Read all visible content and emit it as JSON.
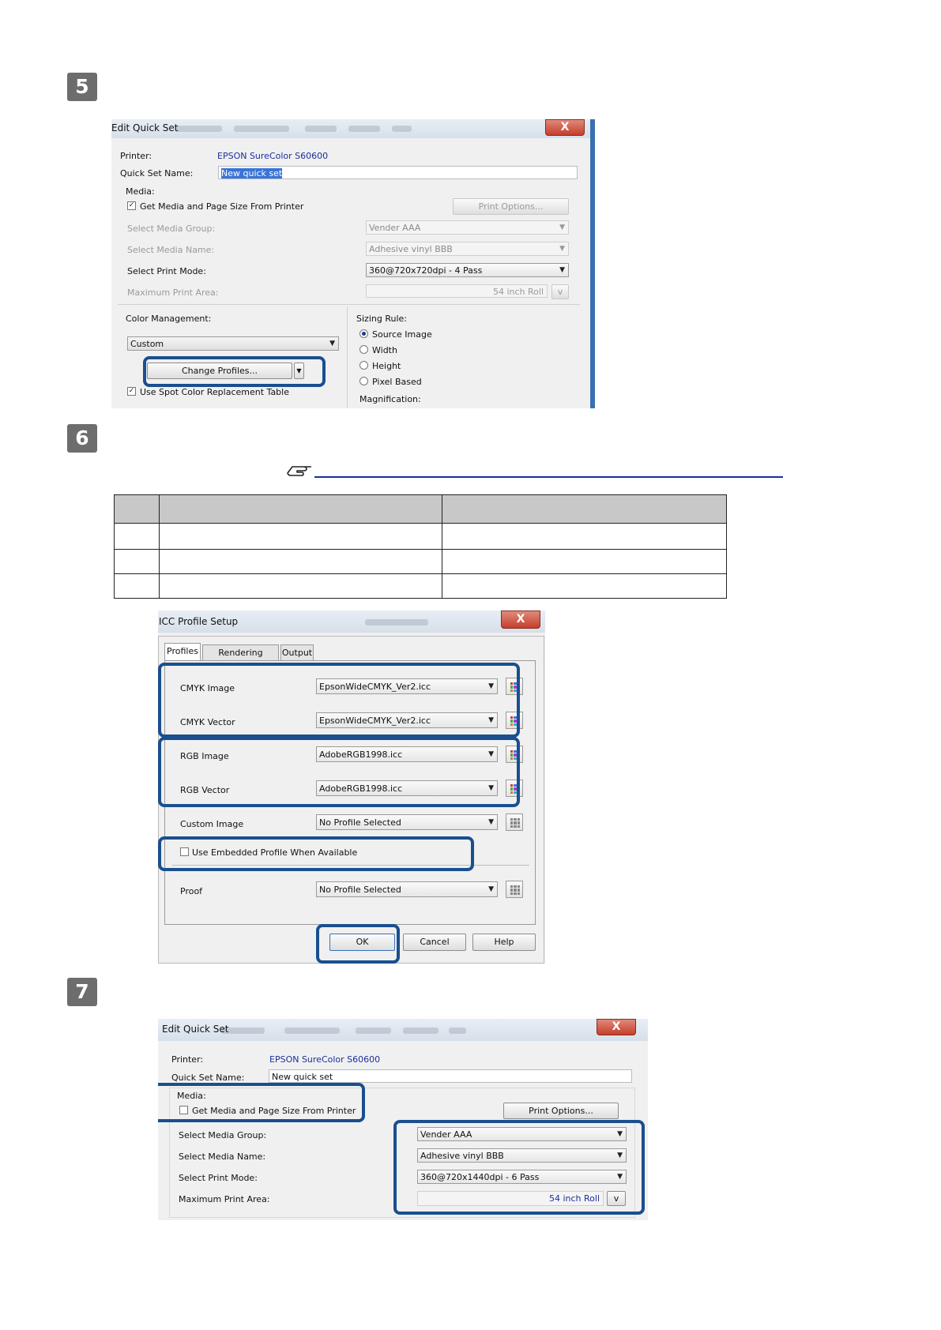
{
  "steps": {
    "s5": "5",
    "s6": "6",
    "s7": "7"
  },
  "dialog1": {
    "title": "Edit Quick Set",
    "close": "X",
    "printer_label": "Printer:",
    "printer_value": "EPSON SureColor S60600",
    "quickset_label": "Quick Set Name:",
    "quickset_value": "New quick set",
    "media_label": "Media:",
    "get_media_label": "Get Media and Page Size From Printer",
    "get_media_checked": "✓",
    "print_options": "Print Options...",
    "media_group_label": "Select Media Group:",
    "media_group_value": "Vender AAA",
    "media_name_label": "Select Media Name:",
    "media_name_value": "Adhesive vinyl BBB",
    "print_mode_label": "Select Print Mode:",
    "print_mode_value": "360@720x720dpi - 4 Pass",
    "max_area_label": "Maximum Print Area:",
    "max_area_value": "54 inch Roll",
    "max_area_btn": "v",
    "color_mgmt_label": "Color Management:",
    "color_mgmt_value": "Custom",
    "change_profiles": "Change Profiles...",
    "spot_color_label": "Use Spot Color Replacement Table",
    "spot_color_checked": "✓",
    "sizing_rule_label": "Sizing Rule:",
    "sizing_options": [
      "Source Image",
      "Width",
      "Height",
      "Pixel Based"
    ],
    "magnification_label": "Magnification:"
  },
  "dialog2": {
    "title": "ICC Profile Setup",
    "close": "X",
    "tabs": [
      "Profiles",
      "Rendering Intents",
      "Output"
    ],
    "cmyk_image_label": "CMYK Image",
    "cmyk_image_value": "EpsonWideCMYK_Ver2.icc",
    "cmyk_vector_label": "CMYK Vector",
    "cmyk_vector_value": "EpsonWideCMYK_Ver2.icc",
    "rgb_image_label": "RGB Image",
    "rgb_image_value": "AdobeRGB1998.icc",
    "rgb_vector_label": "RGB Vector",
    "rgb_vector_value": "AdobeRGB1998.icc",
    "custom_image_label": "Custom Image",
    "custom_image_value": "No Profile Selected",
    "embedded_label": "Use Embedded Profile When Available",
    "proof_label": "Proof",
    "proof_value": "No Profile Selected",
    "ok": "OK",
    "cancel": "Cancel",
    "help": "Help"
  },
  "dialog3": {
    "title": "Edit Quick Set",
    "close": "X",
    "printer_label": "Printer:",
    "printer_value": "EPSON SureColor S60600",
    "quickset_label": "Quick Set Name:",
    "quickset_value": "New quick set",
    "media_label": "Media:",
    "get_media_label": "Get Media and Page Size From Printer",
    "print_options": "Print Options...",
    "media_group_label": "Select Media Group:",
    "media_group_value": "Vender AAA",
    "media_name_label": "Select Media Name:",
    "media_name_value": "Adhesive vinyl BBB",
    "print_mode_label": "Select Print Mode:",
    "print_mode_value": "360@720x1440dpi - 6 Pass",
    "max_area_label": "Maximum Print Area:",
    "max_area_value": "54 inch Roll",
    "max_area_btn": "v"
  },
  "colors": {
    "highlight": "#1a4f8f",
    "badge": "#6d6d6d",
    "link_line": "#1c2f9a",
    "table_header": "#c8c8c8"
  }
}
